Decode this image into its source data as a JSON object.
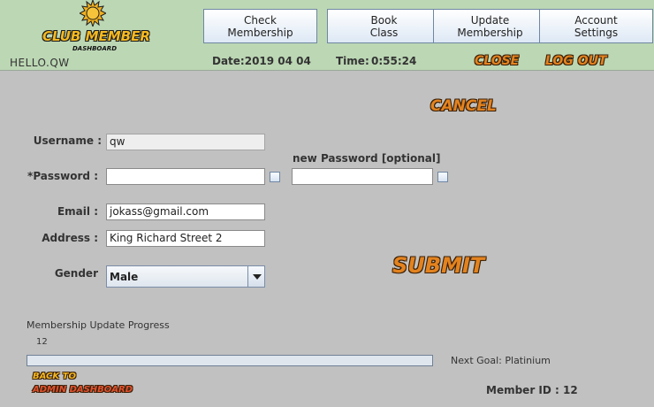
{
  "header": {
    "logo": {
      "title": "CLUB MEMBER",
      "subtitle": "DASHBOARD",
      "icon": "sun-icon"
    },
    "greeting": "HELLO.QW",
    "nav": [
      {
        "label": "Check\nMembership"
      },
      {
        "label": "Book\nClass"
      },
      {
        "label": "Update\nMembership"
      },
      {
        "label": "Account\nSettings"
      }
    ],
    "date_text": "Date:2019 04 04",
    "time_label": "Time:",
    "time_value": "0:55:24",
    "close_label": "CLOSE",
    "logout_label": "LOG OUT"
  },
  "form": {
    "cancel_label": "CANCEL",
    "username_label": "Username :",
    "username_value": "qw",
    "password_label": "*Password :",
    "password_value": "",
    "new_password_label": "new Password [optional]",
    "new_password_value": "",
    "email_label": "Email :",
    "email_value": "jokass@gmail.com",
    "address_label": "Address :",
    "address_value": "King Richard Street 2",
    "gender_label": "Gender",
    "gender_value": "Male",
    "submit_label": "SUBMIT"
  },
  "progress": {
    "title": "Membership Update Progress",
    "value_text": "12",
    "fraction": 0.0,
    "next_goal": "Next Goal: Platinium"
  },
  "footer": {
    "back_line1": "BACK TO",
    "back_line2": "ADMIN DASHBOARD",
    "member_id": "Member ID : 12"
  },
  "colors": {
    "header_bg": "#bcd7b4",
    "body_bg": "#c1c1c1",
    "accent_orange": "#e3831f",
    "accent_yellow": "#f4b820",
    "button_border": "#6f86a2"
  }
}
